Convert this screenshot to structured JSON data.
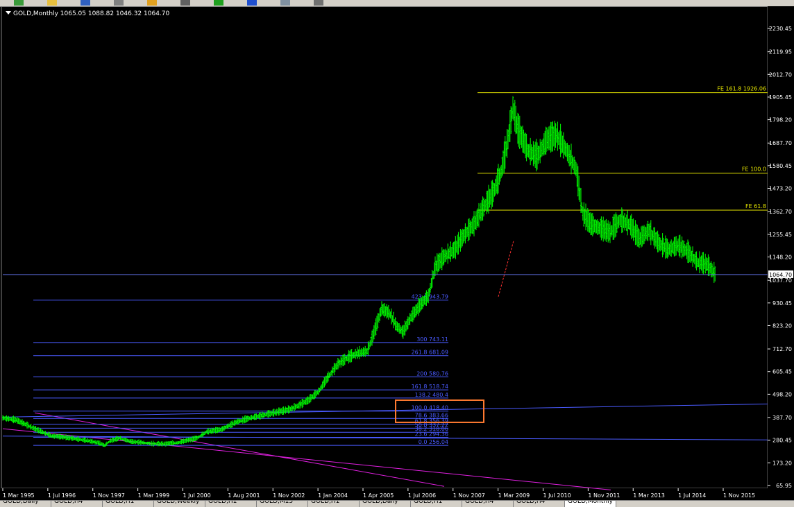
{
  "symbol": "GOLD,Monthly",
  "ohlc": "1065.05 1088.82 1046.32 1064.70",
  "colors": {
    "background": "#000000",
    "up": "#00ff00",
    "down": "#00ff00",
    "fib_retracement": "#4a5bff",
    "fib_expansion": "#e6e600",
    "channel": "#e020e0",
    "bid": "#5a6ad8",
    "highlight_box": "#ff7a30",
    "axis_text": "#ffffff"
  },
  "toolbar": {
    "icons": [
      "arrow-icon",
      "folder-icon",
      "save-icon",
      "crosshair-icon",
      "fib-icon",
      "chart-icon",
      "plus-icon",
      "globe-icon",
      "window-icon",
      "zoom-icon"
    ]
  },
  "tabs": [
    "GOLD,Daily",
    "GOLD,H4",
    "GOLD,H1",
    "GOLD,Weekly",
    "GOLD,H1",
    "GOLD,M15",
    "GOLD,H1",
    "GOLD,Daily",
    "GOLD,H1",
    "GOLD,H4",
    "GOLD,H4",
    "GOLD,Monthly"
  ],
  "chart_data": {
    "type": "ohlc",
    "title": "GOLD,Monthly",
    "ylim": [
      65.95,
      2283
    ],
    "y_ticks": [
      "2230.45",
      "2119.95",
      "2012.70",
      "1905.45",
      "1798.20",
      "1687.70",
      "1580.45",
      "1473.20",
      "1362.70",
      "1255.45",
      "1148.20",
      "1037.70",
      "930.45",
      "823.20",
      "712.70",
      "605.45",
      "498.20",
      "387.70",
      "280.45",
      "173.20",
      "65.95"
    ],
    "x_ticks": [
      "1 Mar 1995",
      "1 Jul 1996",
      "1 Nov 1997",
      "1 Mar 1999",
      "1 Jul 2000",
      "1 Aug 2001",
      "1 Nov 2002",
      "1 Jan 2004",
      "1 Apr 2005",
      "1 Jul 2006",
      "1 Nov 2007",
      "1 Mar 2009",
      "1 Jul 2010",
      "1 Nov 2011",
      "1 Mar 2013",
      "1 Jul 2014",
      "1 Nov 2015"
    ],
    "current_price": "1064.70",
    "fib_retracement_labels": [
      "423.6 943.79",
      "300 743.11",
      "261.8 681.09",
      "200 580.76",
      "161.8 518.74",
      "138.2 480.4",
      "100.0 418.40",
      "78.6 383.66",
      "61.8 356.39",
      "50.0 337.22",
      "38.2 318.06",
      "23.6 294.36",
      "0.0 256.04"
    ],
    "fib_retracement_values": [
      943.79,
      743.11,
      681.09,
      580.76,
      518.74,
      480.4,
      418.4,
      383.66,
      356.39,
      337.22,
      318.06,
      294.36,
      256.04
    ],
    "fib_expansion_labels": [
      "FE 161.8   1926.06",
      "FE 100.0",
      "FE 61.8"
    ],
    "fib_expansion_values": [
      1926.06,
      1545,
      1370
    ],
    "price_path": [
      [
        0,
        385
      ],
      [
        14,
        375
      ],
      [
        30,
        340
      ],
      [
        50,
        300
      ],
      [
        70,
        290
      ],
      [
        90,
        275
      ],
      [
        100,
        265
      ],
      [
        105,
        255
      ],
      [
        110,
        275
      ],
      [
        120,
        290
      ],
      [
        130,
        275
      ],
      [
        150,
        265
      ],
      [
        165,
        262
      ],
      [
        180,
        268
      ],
      [
        200,
        290
      ],
      [
        210,
        320
      ],
      [
        225,
        330
      ],
      [
        240,
        365
      ],
      [
        255,
        385
      ],
      [
        270,
        400
      ],
      [
        280,
        410
      ],
      [
        295,
        425
      ],
      [
        305,
        445
      ],
      [
        315,
        470
      ],
      [
        325,
        510
      ],
      [
        335,
        580
      ],
      [
        345,
        640
      ],
      [
        355,
        670
      ],
      [
        365,
        690
      ],
      [
        375,
        700
      ],
      [
        380,
        760
      ],
      [
        390,
        900
      ],
      [
        398,
        880
      ],
      [
        405,
        820
      ],
      [
        412,
        790
      ],
      [
        420,
        860
      ],
      [
        430,
        920
      ],
      [
        438,
        960
      ],
      [
        445,
        1100
      ],
      [
        455,
        1150
      ],
      [
        465,
        1180
      ],
      [
        475,
        1250
      ],
      [
        485,
        1300
      ],
      [
        495,
        1380
      ],
      [
        505,
        1450
      ],
      [
        513,
        1550
      ],
      [
        520,
        1700
      ],
      [
        525,
        1850
      ],
      [
        530,
        1750
      ],
      [
        540,
        1650
      ],
      [
        550,
        1620
      ],
      [
        560,
        1700
      ],
      [
        570,
        1720
      ],
      [
        580,
        1650
      ],
      [
        590,
        1560
      ],
      [
        597,
        1350
      ],
      [
        605,
        1300
      ],
      [
        615,
        1280
      ],
      [
        625,
        1260
      ],
      [
        635,
        1320
      ],
      [
        645,
        1300
      ],
      [
        655,
        1230
      ],
      [
        665,
        1270
      ],
      [
        675,
        1210
      ],
      [
        685,
        1180
      ],
      [
        695,
        1200
      ],
      [
        705,
        1170
      ],
      [
        715,
        1120
      ],
      [
        725,
        1110
      ],
      [
        733,
        1064
      ]
    ]
  }
}
